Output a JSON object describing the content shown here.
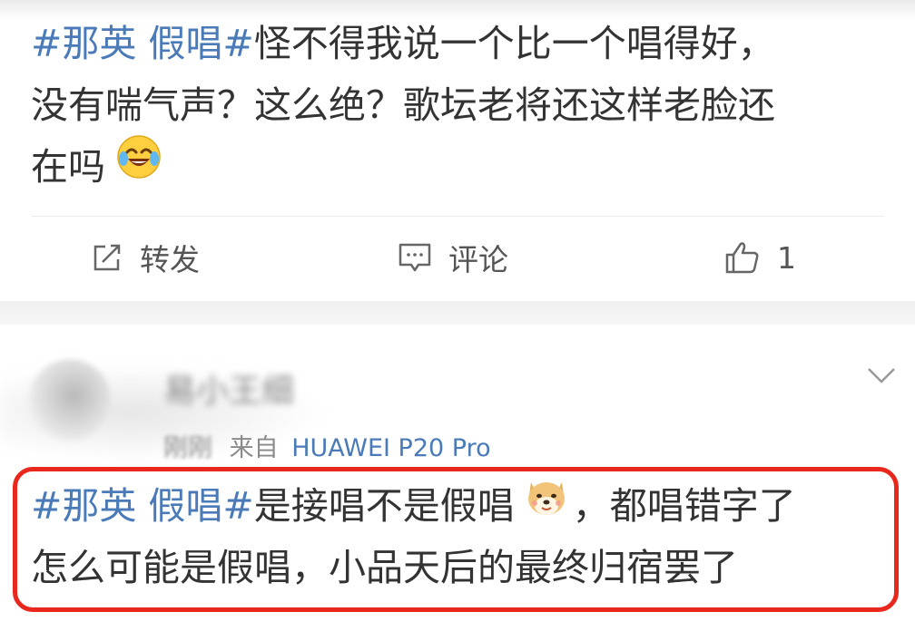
{
  "post1": {
    "text_lines": [
      {
        "tag": "#那英 假唱#",
        "text": "怪不得我说一个比一个唱得好，"
      },
      {
        "tag": "",
        "text": "没有喘气声？这么绝？歌坛老将还这样老脸还"
      },
      {
        "tag": "",
        "text": "在吗"
      }
    ],
    "emoji": "laughing-tears-emoji",
    "actions": {
      "repost_label": "转发",
      "comment_label": "评论",
      "like_count": "1"
    }
  },
  "post2": {
    "username": "易小王细",
    "meta_time": "刚刚",
    "meta_from": "来自",
    "meta_source": "HUAWEI P20 Pro",
    "text_lines": [
      {
        "tag": "#那英 假唱#",
        "text": "是接唱不是假唱",
        "emoji": "doge-emoji",
        "text_after": "，都唱错字了"
      },
      {
        "tag": "",
        "text": "怎么可能是假唱，小品天后的最终归宿罢了"
      }
    ],
    "highlight_color": "#e8271d"
  },
  "colors": {
    "link": "#4a7ab8",
    "text": "#333333",
    "highlight": "#e8271d"
  }
}
